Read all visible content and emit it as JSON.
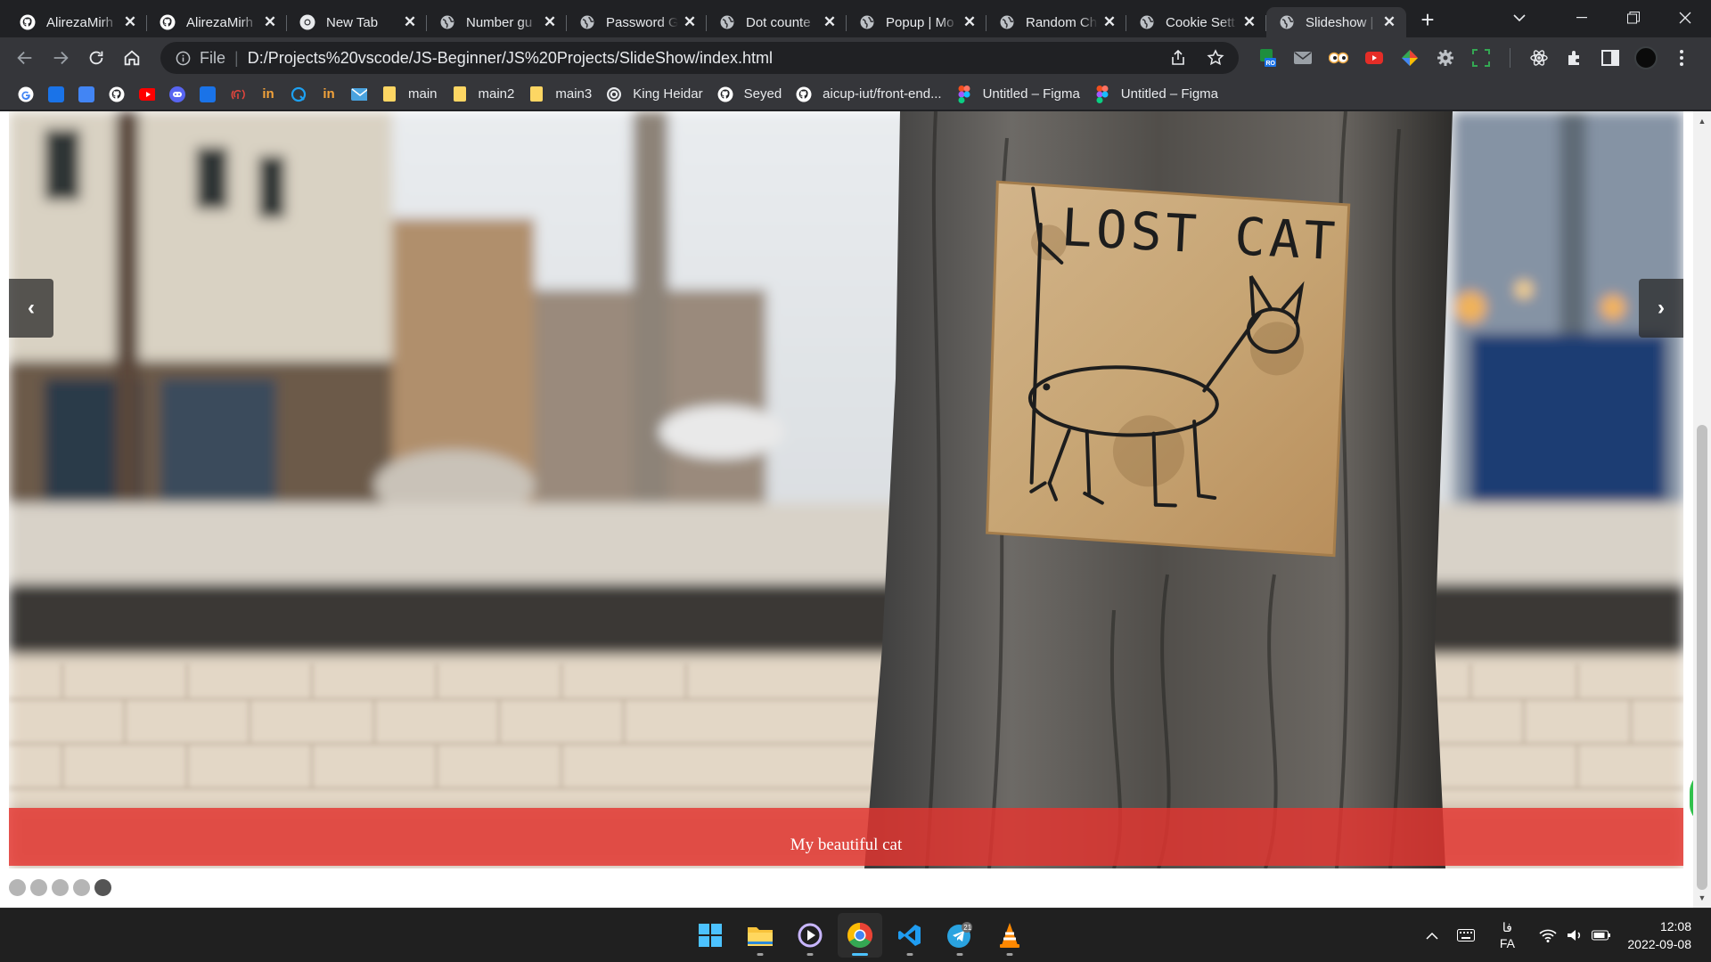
{
  "browser": {
    "tabs": [
      {
        "title": "AlirezaMirh",
        "icon": "github-icon"
      },
      {
        "title": "AlirezaMirh",
        "icon": "github-icon"
      },
      {
        "title": "New Tab",
        "icon": "chrome-icon"
      },
      {
        "title": "Number gu",
        "icon": "globe-icon"
      },
      {
        "title": "Password G",
        "icon": "globe-icon"
      },
      {
        "title": "Dot counte",
        "icon": "globe-icon"
      },
      {
        "title": "Popup | Mo",
        "icon": "globe-icon"
      },
      {
        "title": "Random Ch",
        "icon": "globe-icon"
      },
      {
        "title": "Cookie Sett",
        "icon": "globe-icon"
      },
      {
        "title": "Slideshow |",
        "icon": "globe-icon",
        "active": true
      }
    ],
    "address": {
      "scheme": "File",
      "url": "D:/Projects%20vscode/JS-Beginner/JS%20Projects/SlideShow/index.html"
    },
    "extensions": [
      {
        "name": "ro-extension-icon",
        "color": "#1e8e3e"
      },
      {
        "name": "mail-extension-icon",
        "color": "#9aa0a6"
      },
      {
        "name": "eyes-extension-icon",
        "color": "#e8a33d"
      },
      {
        "name": "youtube-extension-icon",
        "color": "#e52d27"
      },
      {
        "name": "color-picker-extension-icon",
        "color": "#c65cd6"
      },
      {
        "name": "gear-extension-icon",
        "color": "#bdc1c6"
      },
      {
        "name": "screenshot-extension-icon",
        "color": "#34a853"
      },
      {
        "name": "react-devtools-icon",
        "color": "#e8eaed"
      },
      {
        "name": "puzzle-extensions-icon",
        "color": "#e8eaed"
      },
      {
        "name": "side-panel-icon",
        "color": "#e8eaed"
      }
    ],
    "bookmarks": [
      {
        "label": "",
        "icon": "google-icon",
        "color": "#ffffff"
      },
      {
        "label": "",
        "icon": "bookmark-s-icon",
        "color": "#1a73e8"
      },
      {
        "label": "",
        "icon": "docs-icon",
        "color": "#4285f4"
      },
      {
        "label": "",
        "icon": "github-icon",
        "color": "#ffffff"
      },
      {
        "label": "",
        "icon": "youtube-icon",
        "color": "#ff0000"
      },
      {
        "label": "",
        "icon": "discord-icon",
        "color": "#5865f2"
      },
      {
        "label": "",
        "icon": "web-icon",
        "color": "#1a73e8"
      },
      {
        "label": "",
        "icon": "fingerprint-icon",
        "color": "#e8453c"
      },
      {
        "label": "",
        "icon": "invision-icon",
        "color": "#f3a33b"
      },
      {
        "label": "",
        "icon": "q-icon",
        "color": "#1da1f2"
      },
      {
        "label": "",
        "icon": "invision-icon",
        "color": "#f3a33b"
      },
      {
        "label": "",
        "icon": "mail-icon",
        "color": "#4aa3df"
      },
      {
        "label": "main",
        "icon": "folder-icon",
        "color": "#fdd663"
      },
      {
        "label": "main2",
        "icon": "folder-icon",
        "color": "#fdd663"
      },
      {
        "label": "main3",
        "icon": "folder-icon",
        "color": "#fdd663"
      },
      {
        "label": "King Heidar",
        "icon": "site-icon",
        "color": "#e8eaed"
      },
      {
        "label": "Seyed",
        "icon": "github-icon",
        "color": "#ffffff"
      },
      {
        "label": "aicup-iut/front-end...",
        "icon": "github-icon",
        "color": "#ffffff"
      },
      {
        "label": "Untitled – Figma",
        "icon": "figma-icon",
        "color": "#f24e1e"
      },
      {
        "label": "Untitled – Figma",
        "icon": "figma-icon",
        "color": "#f24e1e"
      }
    ]
  },
  "slideshow": {
    "caption": "My beautiful cat",
    "sign_text": "LOST CAT",
    "prev_label": "‹",
    "next_label": "›",
    "slide_count": 5,
    "active_index": 4,
    "caption_color": "#e53530"
  },
  "taskbar": {
    "apps": [
      {
        "name": "windows-start-icon",
        "active": false
      },
      {
        "name": "file-explorer-icon",
        "active": false
      },
      {
        "name": "media-player-icon",
        "active": false
      },
      {
        "name": "chrome-icon",
        "active": true
      },
      {
        "name": "vscode-icon",
        "active": false
      },
      {
        "name": "telegram-icon",
        "active": false,
        "badge": "21"
      },
      {
        "name": "vlc-icon",
        "active": false
      }
    ],
    "lang_top": "فا",
    "lang_bottom": "FA",
    "time": "12:08",
    "date": "2022-09-08"
  }
}
